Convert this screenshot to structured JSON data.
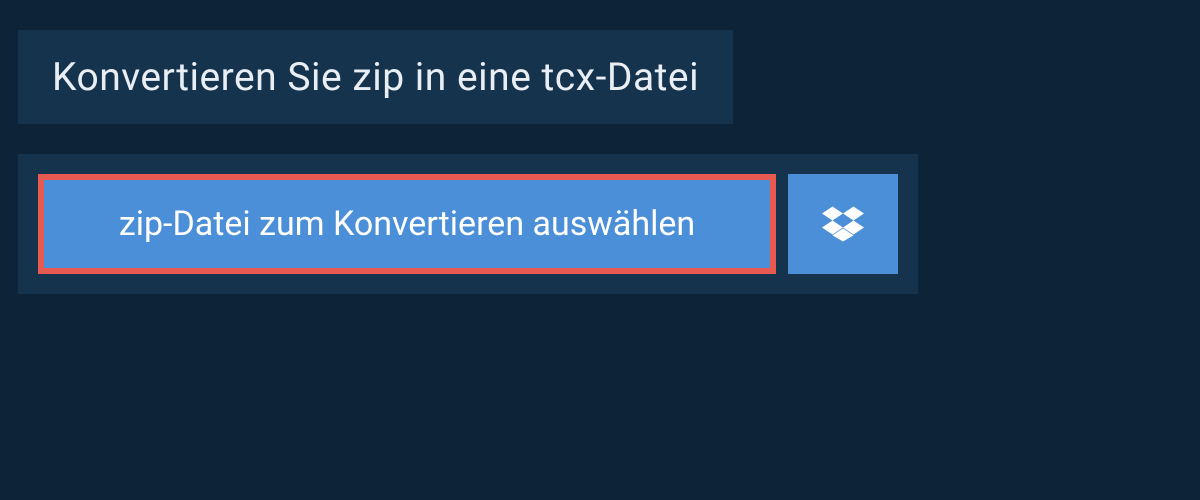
{
  "header": {
    "title": "Konvertieren Sie zip in eine tcx-Datei"
  },
  "upload": {
    "choose_file_label": "zip-Datei zum Konvertieren auswählen",
    "dropbox_icon": "dropbox"
  },
  "colors": {
    "background": "#0d2438",
    "panel": "#15334d",
    "button": "#4a8fd8",
    "highlight_border": "#e85a4f",
    "text_light": "#e8eef3"
  }
}
